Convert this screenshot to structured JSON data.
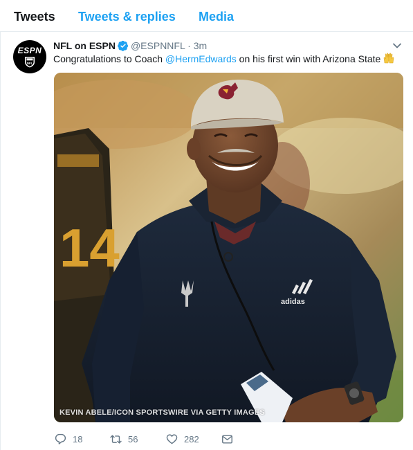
{
  "tabs": [
    {
      "label": "Tweets"
    },
    {
      "label": "Tweets & replies"
    },
    {
      "label": "Media"
    }
  ],
  "tweet": {
    "avatar_text": "ESPN",
    "fullname": "NFL on ESPN",
    "handle": "@ESPNNFL",
    "dot": "·",
    "time": "3m",
    "text_before": "Congratulations to Coach ",
    "mention": "@HermEdwards",
    "text_after": " on his first win with Arizona State",
    "media_credit": "KEVIN ABELE/ICON SPORTSWIRE VIA GETTY IMAGES",
    "jersey_number": "14",
    "shirt_logo": "adidas",
    "actions": {
      "reply_count": "18",
      "retweet_count": "56",
      "like_count": "282"
    }
  },
  "icons": {
    "verified": "verified-badge-icon",
    "caret": "chevron-down-icon",
    "emoji": "raised-hands-emoji",
    "reply": "reply-icon",
    "retweet": "retweet-icon",
    "like": "heart-icon",
    "dm": "envelope-icon"
  },
  "colors": {
    "link": "#1da1f2",
    "text": "#14171a",
    "secondary": "#657786",
    "border": "#e6ecf0"
  }
}
